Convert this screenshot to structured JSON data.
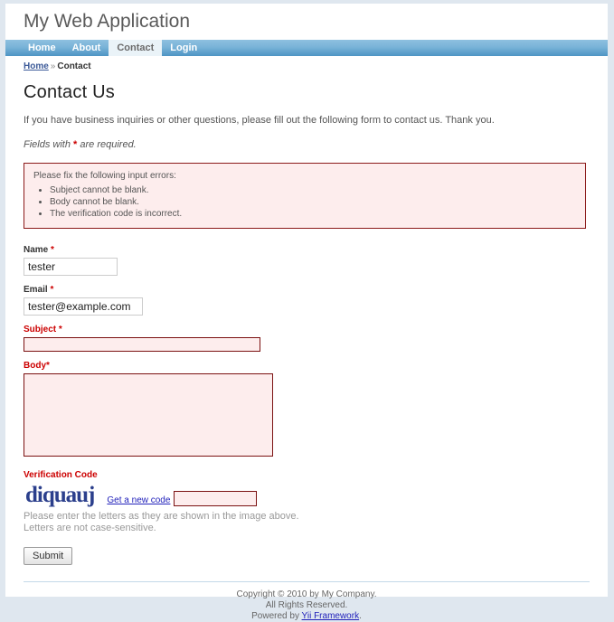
{
  "header": {
    "logo": "My Web Application"
  },
  "nav": {
    "items": [
      {
        "label": "Home",
        "active": false
      },
      {
        "label": "About",
        "active": false
      },
      {
        "label": "Contact",
        "active": true
      },
      {
        "label": "Login",
        "active": false
      }
    ]
  },
  "breadcrumb": {
    "home": "Home",
    "separator": "»",
    "current": "Contact"
  },
  "content": {
    "title": "Contact Us",
    "intro": "If you have business inquiries or other questions, please fill out the following form to contact us. Thank you.",
    "note_before": "Fields with ",
    "note_star": "*",
    "note_after": " are required."
  },
  "error_summary": {
    "heading": "Please fix the following input errors:",
    "items": [
      "Subject cannot be blank.",
      "Body cannot be blank.",
      "The verification code is incorrect."
    ]
  },
  "form": {
    "name": {
      "label": "Name",
      "required_mark": "*",
      "value": "tester",
      "placeholder": ""
    },
    "email": {
      "label": "Email",
      "required_mark": "*",
      "value": "tester@example.com",
      "placeholder": ""
    },
    "subject": {
      "label": "Subject",
      "required_mark": "*",
      "value": "",
      "placeholder": ""
    },
    "body": {
      "label": "Body",
      "required_mark": "*",
      "value": "",
      "placeholder": ""
    },
    "verification": {
      "label": "Verification Code",
      "captcha_text": "diquauj",
      "new_code_link": "Get a new code",
      "value": "",
      "placeholder": "",
      "hint_line1": "Please enter the letters as they are shown in the image above.",
      "hint_line2": "Letters are not case-sensitive."
    },
    "submit_label": "Submit"
  },
  "footer": {
    "line1": "Copyright © 2010 by My Company.",
    "line2": "All Rights Reserved.",
    "powered_prefix": "Powered by ",
    "powered_link": "Yii Framework",
    "powered_suffix": "."
  },
  "colors": {
    "page_background": "#dfe7ef",
    "nav_gradient_top": "#8ec0e0",
    "nav_gradient_bottom": "#4e94c4",
    "error_border": "#8b1a1a",
    "error_background": "#fdeded",
    "required_star": "#cc0000",
    "link": "#2222bb",
    "captcha_text": "#2b3f8c"
  }
}
